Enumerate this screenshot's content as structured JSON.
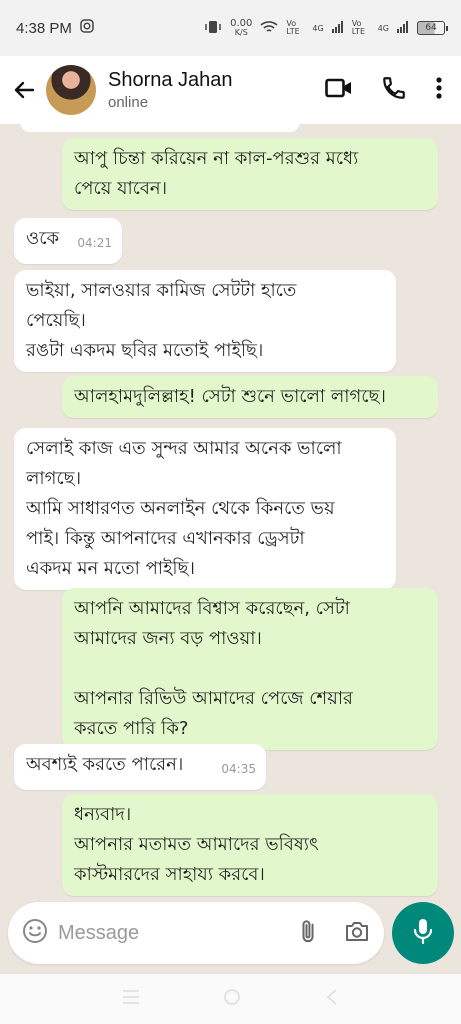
{
  "status_bar": {
    "time": "4:38 PM",
    "speed_value": "0.00",
    "speed_unit": "K/S",
    "net1": "Vo LTE",
    "net1_gen": "4G",
    "net2": "Vo LTE",
    "net2_gen": "4G",
    "battery": "64"
  },
  "header": {
    "contact_name": "Shorna Jahan",
    "contact_status": "online"
  },
  "messages": [
    {
      "dir": "out",
      "lines": [
        "আপু চিন্তা করিয়েন না কাল-পরশুর মধ্যে",
        "পেয়ে যাবেন।"
      ],
      "time": ""
    },
    {
      "dir": "in",
      "lines": [
        "ওকে"
      ],
      "time": "04:21"
    },
    {
      "dir": "in",
      "lines": [
        "ভাইয়া, সালওয়ার কামিজ সেটটা হাতে",
        "পেয়েছি।",
        "রঙটা একদম ছবির মতোই পাইছি।"
      ],
      "time": ""
    },
    {
      "dir": "out",
      "lines": [
        "আলহামদুলিল্লাহ! সেটা শুনে ভালো লাগছে।"
      ],
      "time": ""
    },
    {
      "dir": "in",
      "lines": [
        "সেলাই কাজ এত সুন্দর আমার অনেক ভালো",
        "লাগছে।",
        "আমি সাধারণত অনলাইন থেকে কিনতে ভয়",
        "পাই। কিন্তু আপনাদের এখানকার ড্রেসটা",
        "একদম মন মতো পাইছি।"
      ],
      "time": ""
    },
    {
      "dir": "out",
      "lines": [
        "আপনি আমাদের বিশ্বাস করেছেন, সেটা",
        "আমাদের জন্য বড় পাওয়া।",
        "",
        "আপনার রিভিউ আমাদের পেজে শেয়ার",
        "করতে পারি কি?"
      ],
      "time": ""
    },
    {
      "dir": "in",
      "lines": [
        "অবশ্যই করতে পারেন।"
      ],
      "time": "04:35"
    },
    {
      "dir": "out",
      "lines": [
        "ধন্যবাদ।",
        "আপনার মতামত আমাদের ভবিষ্যৎ",
        "কাস্টমারদের সাহায্য করবে।"
      ],
      "time": ""
    }
  ],
  "composer": {
    "placeholder": "Message"
  },
  "icons": {
    "back": "arrow-back-icon",
    "video": "video-call-icon",
    "call": "phone-call-icon",
    "menu": "more-vert-icon",
    "emoji": "emoji-icon",
    "attach": "paperclip-icon",
    "camera": "camera-icon",
    "mic": "mic-icon"
  },
  "colors": {
    "incoming_bubble": "#ffffff",
    "outgoing_bubble": "#e2f7cb",
    "accent": "#00897b",
    "background": "#ece5dd"
  }
}
